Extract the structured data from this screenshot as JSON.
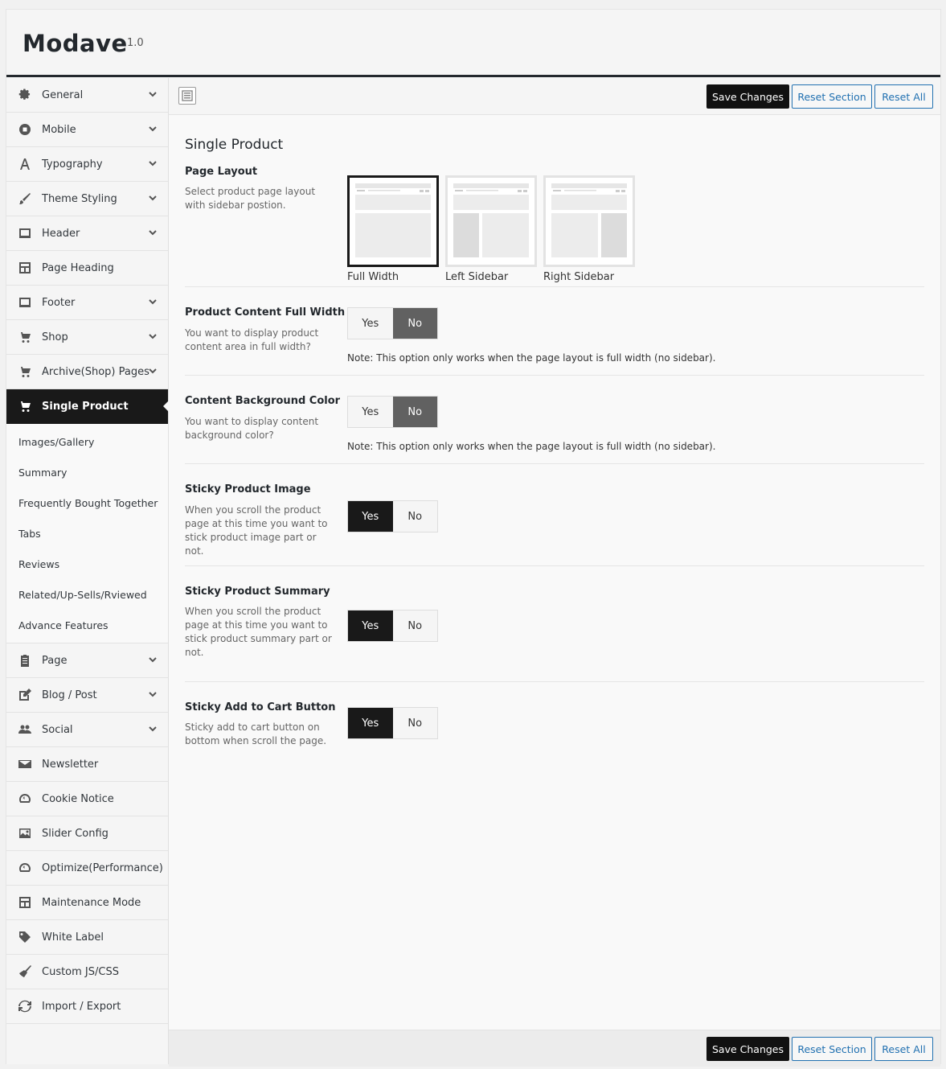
{
  "app": {
    "title": "Modave",
    "version": "1.0"
  },
  "toolbar": {
    "save_label": "Save Changes",
    "reset_section_label": "Reset Section",
    "reset_all_label": "Reset All"
  },
  "sidebar": {
    "items_before": [
      {
        "label": "General",
        "icon": "gear-icon",
        "expandable": true
      },
      {
        "label": "Mobile",
        "icon": "mobile-icon",
        "expandable": true
      },
      {
        "label": "Typography",
        "icon": "font-icon",
        "expandable": true
      },
      {
        "label": "Theme Styling",
        "icon": "brush-icon",
        "expandable": true
      },
      {
        "label": "Header",
        "icon": "header-icon",
        "expandable": true
      },
      {
        "label": "Page Heading",
        "icon": "layout-icon",
        "expandable": false
      },
      {
        "label": "Footer",
        "icon": "footer-icon",
        "expandable": true
      },
      {
        "label": "Shop",
        "icon": "cart-icon",
        "expandable": true
      },
      {
        "label": "Archive(Shop) Pages",
        "icon": "cart-icon",
        "expandable": true
      }
    ],
    "active": {
      "label": "Single Product",
      "icon": "cart-icon"
    },
    "subitems": [
      "Images/Gallery",
      "Summary",
      "Frequently Bought Together",
      "Tabs",
      "Reviews",
      "Related/Up-Sells/Rviewed",
      "Advance Features"
    ],
    "items_after": [
      {
        "label": "Page",
        "icon": "clipboard-icon",
        "expandable": true
      },
      {
        "label": "Blog / Post",
        "icon": "edit-icon",
        "expandable": true
      },
      {
        "label": "Social",
        "icon": "users-icon",
        "expandable": true
      },
      {
        "label": "Newsletter",
        "icon": "envelope-icon",
        "expandable": false
      },
      {
        "label": "Cookie Notice",
        "icon": "dashboard-icon",
        "expandable": false
      },
      {
        "label": "Slider Config",
        "icon": "image-icon",
        "expandable": false
      },
      {
        "label": "Optimize(Performance)",
        "icon": "dashboard-icon",
        "expandable": false
      },
      {
        "label": "Maintenance Mode",
        "icon": "layout-icon",
        "expandable": false
      },
      {
        "label": "White Label",
        "icon": "tag-icon",
        "expandable": false
      },
      {
        "label": "Custom JS/CSS",
        "icon": "broom-icon",
        "expandable": false
      },
      {
        "label": "Import / Export",
        "icon": "refresh-icon",
        "expandable": false
      }
    ]
  },
  "section": {
    "title": "Single Product",
    "page_layout": {
      "title": "Page Layout",
      "desc": "Select product page layout with sidebar postion.",
      "options": [
        {
          "label": "Full Width",
          "selected": true
        },
        {
          "label": "Left Sidebar",
          "selected": false
        },
        {
          "label": "Right Sidebar",
          "selected": false
        }
      ]
    },
    "fields": [
      {
        "title": "Product Content Full Width",
        "desc": "You want to display product content area in full width?",
        "yes": "Yes",
        "no": "No",
        "value": "No",
        "note": "Note: This option only works when the page layout is full width (no sidebar)."
      },
      {
        "title": "Content Background Color",
        "desc": "You want to display content background color?",
        "yes": "Yes",
        "no": "No",
        "value": "No",
        "note": "Note: This option only works when the page layout is full width (no sidebar)."
      },
      {
        "title": "Sticky Product Image",
        "desc": "When you scroll the product page at this time you want to stick product image part or not.",
        "yes": "Yes",
        "no": "No",
        "value": "Yes"
      },
      {
        "title": "Sticky Product Summary",
        "desc": "When you scroll the product page at this time you want to stick product summary part or not.",
        "yes": "Yes",
        "no": "No",
        "value": "Yes"
      },
      {
        "title": "Sticky Add to Cart Button",
        "desc": "Sticky add to cart button on bottom when scroll the page.",
        "yes": "Yes",
        "no": "No",
        "value": "Yes"
      }
    ]
  }
}
